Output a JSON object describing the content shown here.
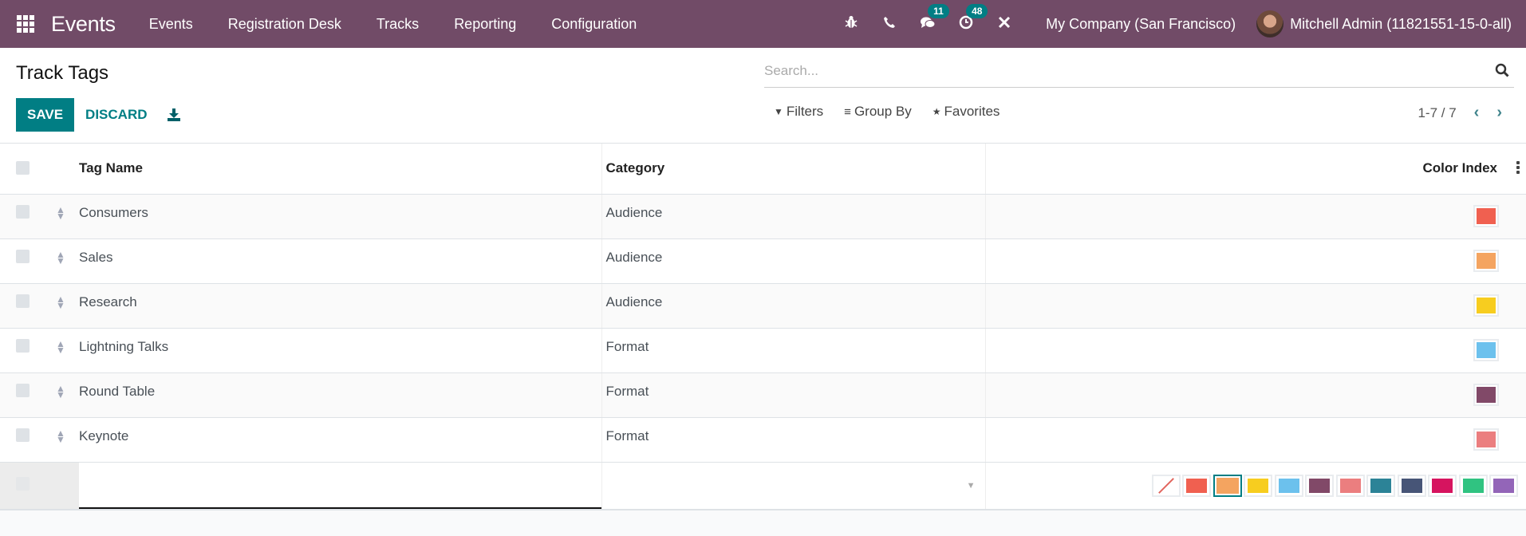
{
  "navbar": {
    "app_name": "Events",
    "menu": [
      "Events",
      "Registration Desk",
      "Tracks",
      "Reporting",
      "Configuration"
    ],
    "icons": [
      "bug-icon",
      "phone-icon",
      "chat-icon",
      "activity-clock-icon",
      "tools-icon"
    ],
    "messages_count": "11",
    "activities_count": "48",
    "company": "My Company (San Francisco)",
    "user": "Mitchell Admin (11821551-15-0-all)"
  },
  "control_panel": {
    "title": "Track Tags",
    "save_label": "SAVE",
    "discard_label": "DISCARD",
    "search_placeholder": "Search...",
    "filters_label": "Filters",
    "group_by_label": "Group By",
    "favorites_label": "Favorites",
    "pager": "1-7 / 7"
  },
  "list": {
    "columns": [
      "Tag Name",
      "Category",
      "Color Index"
    ],
    "rows": [
      {
        "name": "Consumers",
        "category": "Audience",
        "color": "#f06050"
      },
      {
        "name": "Sales",
        "category": "Audience",
        "color": "#f4a460"
      },
      {
        "name": "Research",
        "category": "Audience",
        "color": "#f7cd1f"
      },
      {
        "name": "Lightning Talks",
        "category": "Format",
        "color": "#6cc1ed"
      },
      {
        "name": "Round Table",
        "category": "Format",
        "color": "#814968"
      },
      {
        "name": "Keynote",
        "category": "Format",
        "color": "#eb7e7f"
      }
    ],
    "editing_row": {
      "name_value": "",
      "category_value": "",
      "palette": [
        "none",
        "#f06050",
        "#f4a460",
        "#f7cd1f",
        "#6cc1ed",
        "#814968",
        "#eb7e7f",
        "#2c8397",
        "#475577",
        "#d6145f",
        "#30c381",
        "#9365b8"
      ],
      "selected_color_index": 2
    }
  },
  "colors": {
    "navbar": "#714b67",
    "primary": "#017e84"
  }
}
